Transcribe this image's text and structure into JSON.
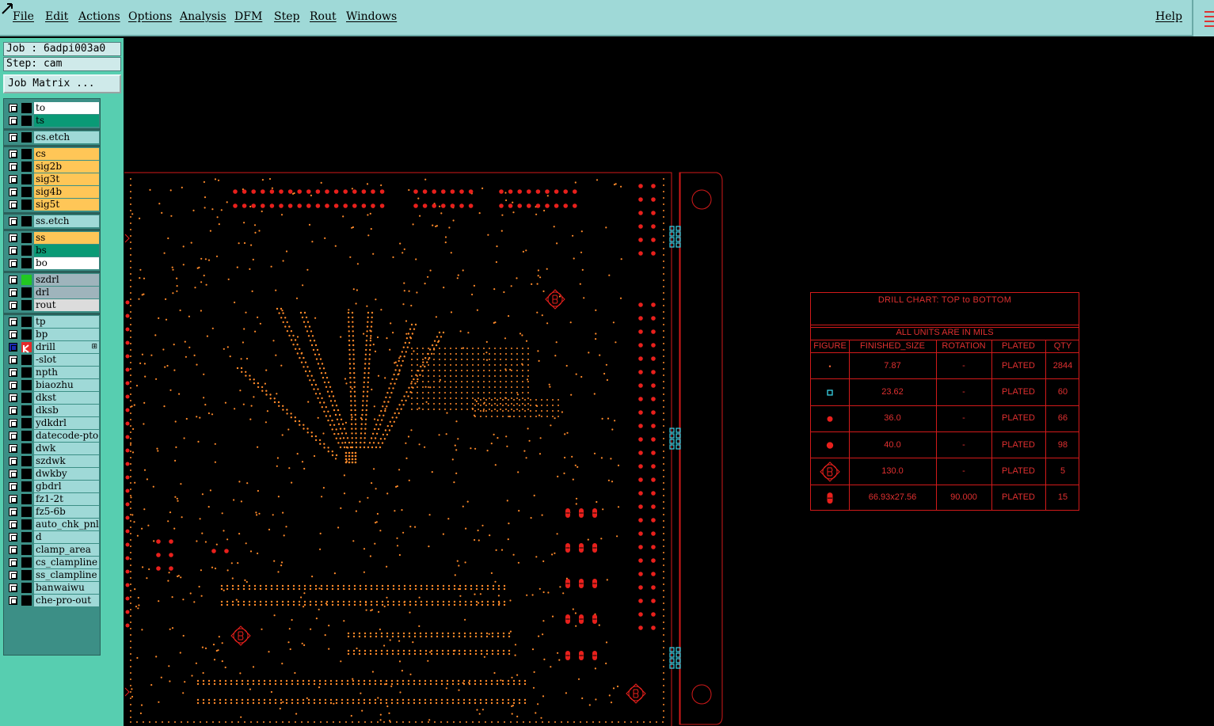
{
  "menubar": {
    "items": [
      "File",
      "Edit",
      "Actions",
      "Options",
      "Analysis",
      "DFM",
      "Step",
      "Rout",
      "Windows"
    ],
    "help": "Help"
  },
  "panel": {
    "job_label": "Job : 6adpi003a0",
    "step_label": "Step: cam",
    "job_matrix": "Job Matrix ..."
  },
  "layers": [
    {
      "name": "to",
      "color": "#ffffff"
    },
    {
      "name": "ts",
      "color": "#0a9a76"
    },
    {
      "name": "cs.etch",
      "color": "#9fd9d7"
    },
    {
      "name": "cs",
      "color": "#ffc657"
    },
    {
      "name": "sig2b",
      "color": "#ffc657"
    },
    {
      "name": "sig3t",
      "color": "#ffc657"
    },
    {
      "name": "sig4b",
      "color": "#ffc657"
    },
    {
      "name": "sig5t",
      "color": "#ffc657"
    },
    {
      "name": "ss.etch",
      "color": "#9fd9d7"
    },
    {
      "name": "ss",
      "color": "#ffc657"
    },
    {
      "name": "bs",
      "color": "#0a9a76"
    },
    {
      "name": "bo",
      "color": "#ffffff"
    },
    {
      "name": "szdrl",
      "color": "#9fb4bc"
    },
    {
      "name": "drl",
      "color": "#9fb4bc"
    },
    {
      "name": "rout",
      "color": "#dcdcdc"
    },
    {
      "name": "tp",
      "color": "#9fd9d7"
    },
    {
      "name": "bp",
      "color": "#9fd9d7"
    },
    {
      "name": "drill",
      "color": "#9fd9d7"
    },
    {
      "name": "-slot",
      "color": "#9fd9d7"
    },
    {
      "name": "npth",
      "color": "#9fd9d7"
    },
    {
      "name": "biaozhu",
      "color": "#9fd9d7"
    },
    {
      "name": "dkst",
      "color": "#9fd9d7"
    },
    {
      "name": "dksb",
      "color": "#9fd9d7"
    },
    {
      "name": "ydkdrl",
      "color": "#9fd9d7"
    },
    {
      "name": "datecode-pto",
      "color": "#9fd9d7"
    },
    {
      "name": "dwk",
      "color": "#9fd9d7"
    },
    {
      "name": "szdwk",
      "color": "#9fd9d7"
    },
    {
      "name": "dwkby",
      "color": "#9fd9d7"
    },
    {
      "name": "gbdrl",
      "color": "#9fd9d7"
    },
    {
      "name": "fz1-2t",
      "color": "#9fd9d7"
    },
    {
      "name": "fz5-6b",
      "color": "#9fd9d7"
    },
    {
      "name": "auto_chk_pnl",
      "color": "#9fd9d7"
    },
    {
      "name": "d",
      "color": "#9fd9d7"
    },
    {
      "name": "clamp_area",
      "color": "#9fd9d7"
    },
    {
      "name": "cs_clampline",
      "color": "#9fd9d7"
    },
    {
      "name": "ss_clampline",
      "color": "#9fd9d7"
    },
    {
      "name": "banwaiwu",
      "color": "#9fd9d7"
    },
    {
      "name": "che-pro-out",
      "color": "#9fd9d7"
    }
  ],
  "drill_chart": {
    "title": "DRILL CHART: TOP to BOTTOM",
    "units": "ALL UNITS ARE IN MILS",
    "headers": [
      "FIGURE",
      "FINISHED_SIZE",
      "ROTATION",
      "PLATED",
      "QTY"
    ],
    "rows": [
      {
        "size": "7.87",
        "rotation": "-",
        "plated": "PLATED",
        "qty": "2844"
      },
      {
        "size": "23.62",
        "rotation": "-",
        "plated": "PLATED",
        "qty": "60"
      },
      {
        "size": "36.0",
        "rotation": "-",
        "plated": "PLATED",
        "qty": "66"
      },
      {
        "size": "40.0",
        "rotation": "-",
        "plated": "PLATED",
        "qty": "98"
      },
      {
        "size": "130.0",
        "rotation": "-",
        "plated": "PLATED",
        "qty": "5"
      },
      {
        "size": "66.93x27.56",
        "rotation": "90.000",
        "plated": "PLATED",
        "qty": "15"
      }
    ]
  },
  "colors": {
    "menu_bg": "#9fd9d7",
    "panel_bg": "#57ceb0",
    "canvas_bg": "#000000",
    "pad_orange": "#ff8a2a",
    "pad_red": "#e8201c",
    "slot_cyan": "#39d4e8",
    "outline": "#d21a1a"
  }
}
